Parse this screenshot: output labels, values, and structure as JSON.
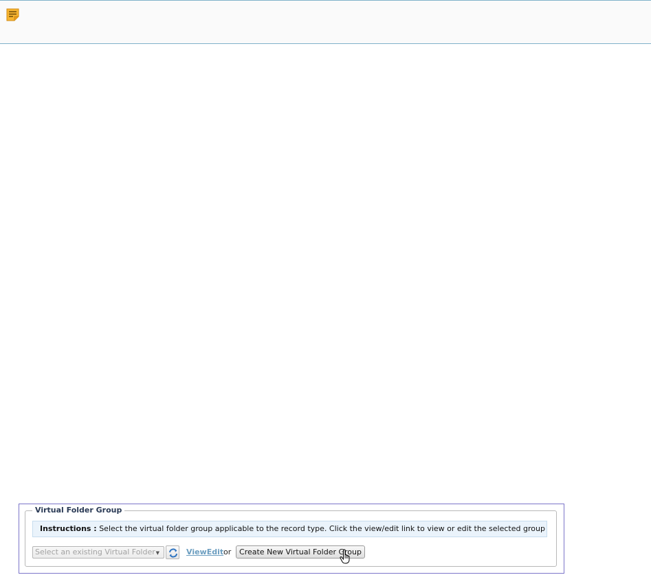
{
  "note_bar": {
    "icon": "note-icon"
  },
  "virtual_folder_group": {
    "legend": "Virtual Folder Group",
    "instructions_label": "Instructions :",
    "instructions_text": " Select the virtual folder group applicable to the record type. Click the view/edit link to view or edit the selected group",
    "select_placeholder": "Select an existing Virtual Folder",
    "refresh_icon": "refresh-icon",
    "view_edit_link": "ViewEdit",
    "or_text": "or",
    "create_button": "Create New Virtual Folder Group"
  },
  "colors": {
    "frame_border": "#7b74c9",
    "note_border": "#7fb1c9",
    "instructions_bg": "#eaf3fb",
    "link": "#6c9ec0"
  }
}
